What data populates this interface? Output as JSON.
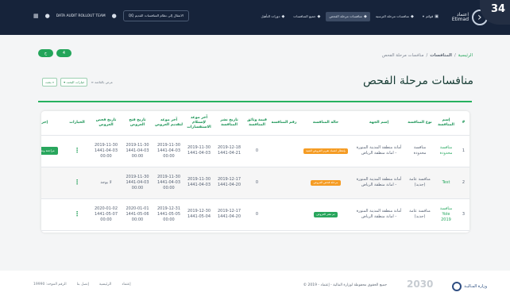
{
  "header": {
    "user_name": "DATA AUDIT ROLLOUT TEAM",
    "switch_label": "الانتقال إلى نظام المنافسات القديم",
    "switch_code": "QQ",
    "brand": [
      "اعتماد",
      "Etimad"
    ],
    "menu": [
      {
        "label": "دورات التأهيل",
        "icon": "graduation-icon"
      },
      {
        "label": "جميع المنافسات",
        "icon": "graduation-icon"
      },
      {
        "label": "منافسات مرحلة الفحص",
        "icon": "graduation-icon",
        "active": true
      },
      {
        "label": "منافسات مرحلة الترسية",
        "icon": "graduation-icon"
      },
      {
        "label": "قوائم",
        "icon": "menu-icon"
      }
    ]
  },
  "corner_number": "34",
  "toolbar": {
    "button_one": "ج",
    "button_two": "4"
  },
  "breadcrumb": [
    "الرئيسية",
    "المنافسات",
    "منافسات مرحلة الفحص"
  ],
  "page": {
    "title": "منافسات مرحلة الفحص",
    "view_label": "عرض بالقائمة",
    "options_button": "خيارات البحث",
    "search_button": "بحث"
  },
  "table": {
    "columns": [
      "#",
      "إسم المنافسة",
      "نوع المنافسة",
      "إسم الجهة",
      "حالة المنافسة",
      "رقم المنافسة",
      "قيمة وثائق المنافسة",
      "تاريخ نشر المنافسة",
      "آخر موعد لإستلام الاستفسارات",
      "آخر موعد لتقديم العروض",
      "تاريخ فتح العروض",
      "تاريخ فحص العروض",
      "الخيارات",
      "إجراءات"
    ],
    "rows": [
      {
        "number": "1",
        "name": "منافسة محدودة",
        "type": "منافسة محدودة",
        "entity": "أمانة منطقة المدينة المنورة - امانة منطقة الرياض",
        "status": "بإنتظار اعتماد تقرير العروض الفنية",
        "status_color": "orange",
        "competition_number": "",
        "document_value": "0",
        "publish_date": "2019-12-18 1441-04-21",
        "questions_deadline": "2019-11-30 1441-04-03",
        "offers_deadline": "2019-11-30 1441-04-03 00:00",
        "opening_date": "2019-11-30 1441-04-03 00:00",
        "examination_date": "2019-11-30 1441-04-03 00:00",
        "options": "⋮",
        "action": "مراجعة وتدقيق البيانات"
      },
      {
        "number": "2",
        "name": "Test",
        "type": "منافسة عامة (جديد)",
        "entity": "أمانة منطقة المدينة المنورة - امانة منطقة الرياض",
        "status": "مرحلة فحص العروض",
        "status_color": "orange",
        "competition_number": "",
        "document_value": "0",
        "publish_date": "2019-12-17 1441-04-20",
        "questions_deadline": "2019-11-30 1441-04-03",
        "offers_deadline": "2019-11-30 1441-04-03 00:00",
        "opening_date": "2019-11-30 1441-04-03 00:00",
        "examination_date": "لا يوجد",
        "options": "⋮",
        "action": ""
      },
      {
        "number": "3",
        "name": "منافسة Yole 2019",
        "type": "منافسة عامة (جديد)",
        "entity": "أمانة منطقة المدينة المنورة - امانة منطقة الرياض",
        "status": "تم نشر العروض",
        "status_color": "green",
        "competition_number": "",
        "document_value": "0",
        "publish_date": "2019-12-17 1441-04-20",
        "questions_deadline": "2019-12-30 1441-05-04",
        "offers_deadline": "2019-12-31 1441-05-05 00:00",
        "opening_date": "2020-01-01 1441-05-06 00:00",
        "examination_date": "2020-01-02 1441-05-07 00:00",
        "options": "⋮",
        "action": ""
      }
    ]
  },
  "footer": {
    "links": [
      "إعتماد",
      "الرئيسية",
      "إتصل بنا",
      "الرقم الموحد: 19990"
    ],
    "copyright": "جميع الحقوق محفوظة لوزارة المالية - إعتماد - 2019 ©",
    "vision": "2030",
    "ministry": "وزارة المـاليـة"
  },
  "colors": {
    "navbar": "#16233a",
    "brand_green": "#26b15f",
    "table_header_text": "#189354",
    "status_orange": "#f59c24",
    "status_green": "#29a65d"
  }
}
